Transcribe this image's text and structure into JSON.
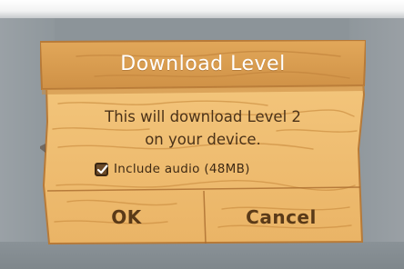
{
  "dialog": {
    "title": "Download Level",
    "message_line1": "This will download Level 2",
    "message_line2": "on your device.",
    "checkbox": {
      "label": "Include audio (48MB)",
      "checked": true
    },
    "buttons": {
      "ok_label": "OK",
      "cancel_label": "Cancel"
    }
  },
  "colors": {
    "wood_light": "#f3c57a",
    "wood_mid": "#e8b062",
    "wood_dark": "#b97b3a",
    "title_band": "#d59a4c",
    "text_dark": "#4b3218",
    "backdrop": "#8c9499"
  }
}
